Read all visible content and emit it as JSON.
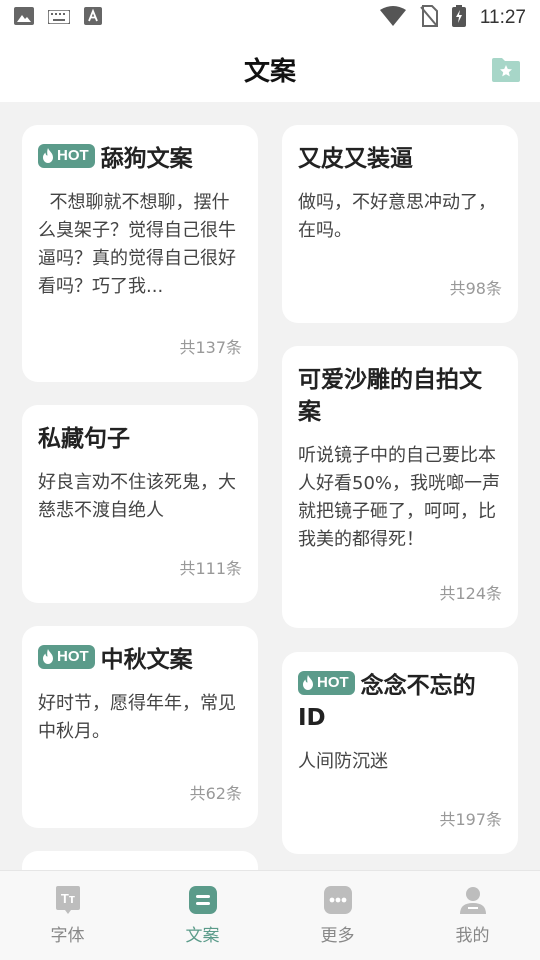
{
  "status_bar": {
    "time": "11:27"
  },
  "header": {
    "title": "文案"
  },
  "hot_label": "HOT",
  "cards_left": [
    {
      "hot": true,
      "title": "舔狗文案",
      "body": "  不想聊就不想聊，摆什么臭架子？觉得自己很牛逼吗？真的觉得自己很好看吗？巧了我...",
      "count": "共137条"
    },
    {
      "hot": false,
      "title": "私藏句子",
      "body": "好良言劝不住该死鬼，大慈悲不渡自绝人",
      "count": "共111条"
    },
    {
      "hot": true,
      "title": "中秋文案",
      "body": "好时节，愿得年年，常见中秋月。",
      "count": "共62条"
    }
  ],
  "cards_right": [
    {
      "hot": false,
      "title": "又皮又装逼",
      "body": "做吗，不好意思冲动了，在吗。",
      "count": "共98条"
    },
    {
      "hot": false,
      "title": "可爱沙雕的自拍文案",
      "body": "听说镜子中的自己要比本人好看50%，我咣啷一声就把镜子砸了，呵呵，比我美的都得死！",
      "count": "共124条"
    },
    {
      "hot": true,
      "title": "念念不忘的ID",
      "body": "人间防沉迷",
      "count": "共197条"
    }
  ],
  "nav": [
    {
      "label": "字体",
      "icon": "font-icon",
      "active": false
    },
    {
      "label": "文案",
      "icon": "copywriting-icon",
      "active": true
    },
    {
      "label": "更多",
      "icon": "more-icon",
      "active": false
    },
    {
      "label": "我的",
      "icon": "profile-icon",
      "active": false
    }
  ],
  "colors": {
    "accent": "#5b9b8a",
    "background": "#f2f2f2",
    "card": "#ffffff"
  }
}
